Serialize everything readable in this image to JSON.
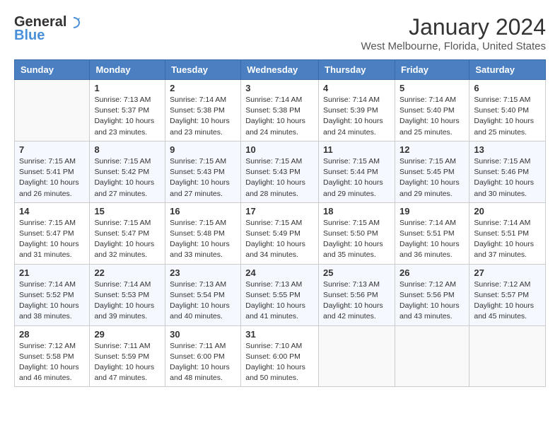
{
  "header": {
    "logo_general": "General",
    "logo_blue": "Blue",
    "title": "January 2024",
    "subtitle": "West Melbourne, Florida, United States"
  },
  "days_of_week": [
    "Sunday",
    "Monday",
    "Tuesday",
    "Wednesday",
    "Thursday",
    "Friday",
    "Saturday"
  ],
  "weeks": [
    [
      {
        "day": "",
        "info": ""
      },
      {
        "day": "1",
        "info": "Sunrise: 7:13 AM\nSunset: 5:37 PM\nDaylight: 10 hours\nand 23 minutes."
      },
      {
        "day": "2",
        "info": "Sunrise: 7:14 AM\nSunset: 5:38 PM\nDaylight: 10 hours\nand 23 minutes."
      },
      {
        "day": "3",
        "info": "Sunrise: 7:14 AM\nSunset: 5:38 PM\nDaylight: 10 hours\nand 24 minutes."
      },
      {
        "day": "4",
        "info": "Sunrise: 7:14 AM\nSunset: 5:39 PM\nDaylight: 10 hours\nand 24 minutes."
      },
      {
        "day": "5",
        "info": "Sunrise: 7:14 AM\nSunset: 5:40 PM\nDaylight: 10 hours\nand 25 minutes."
      },
      {
        "day": "6",
        "info": "Sunrise: 7:15 AM\nSunset: 5:40 PM\nDaylight: 10 hours\nand 25 minutes."
      }
    ],
    [
      {
        "day": "7",
        "info": "Sunrise: 7:15 AM\nSunset: 5:41 PM\nDaylight: 10 hours\nand 26 minutes."
      },
      {
        "day": "8",
        "info": "Sunrise: 7:15 AM\nSunset: 5:42 PM\nDaylight: 10 hours\nand 27 minutes."
      },
      {
        "day": "9",
        "info": "Sunrise: 7:15 AM\nSunset: 5:43 PM\nDaylight: 10 hours\nand 27 minutes."
      },
      {
        "day": "10",
        "info": "Sunrise: 7:15 AM\nSunset: 5:43 PM\nDaylight: 10 hours\nand 28 minutes."
      },
      {
        "day": "11",
        "info": "Sunrise: 7:15 AM\nSunset: 5:44 PM\nDaylight: 10 hours\nand 29 minutes."
      },
      {
        "day": "12",
        "info": "Sunrise: 7:15 AM\nSunset: 5:45 PM\nDaylight: 10 hours\nand 29 minutes."
      },
      {
        "day": "13",
        "info": "Sunrise: 7:15 AM\nSunset: 5:46 PM\nDaylight: 10 hours\nand 30 minutes."
      }
    ],
    [
      {
        "day": "14",
        "info": "Sunrise: 7:15 AM\nSunset: 5:47 PM\nDaylight: 10 hours\nand 31 minutes."
      },
      {
        "day": "15",
        "info": "Sunrise: 7:15 AM\nSunset: 5:47 PM\nDaylight: 10 hours\nand 32 minutes."
      },
      {
        "day": "16",
        "info": "Sunrise: 7:15 AM\nSunset: 5:48 PM\nDaylight: 10 hours\nand 33 minutes."
      },
      {
        "day": "17",
        "info": "Sunrise: 7:15 AM\nSunset: 5:49 PM\nDaylight: 10 hours\nand 34 minutes."
      },
      {
        "day": "18",
        "info": "Sunrise: 7:15 AM\nSunset: 5:50 PM\nDaylight: 10 hours\nand 35 minutes."
      },
      {
        "day": "19",
        "info": "Sunrise: 7:14 AM\nSunset: 5:51 PM\nDaylight: 10 hours\nand 36 minutes."
      },
      {
        "day": "20",
        "info": "Sunrise: 7:14 AM\nSunset: 5:51 PM\nDaylight: 10 hours\nand 37 minutes."
      }
    ],
    [
      {
        "day": "21",
        "info": "Sunrise: 7:14 AM\nSunset: 5:52 PM\nDaylight: 10 hours\nand 38 minutes."
      },
      {
        "day": "22",
        "info": "Sunrise: 7:14 AM\nSunset: 5:53 PM\nDaylight: 10 hours\nand 39 minutes."
      },
      {
        "day": "23",
        "info": "Sunrise: 7:13 AM\nSunset: 5:54 PM\nDaylight: 10 hours\nand 40 minutes."
      },
      {
        "day": "24",
        "info": "Sunrise: 7:13 AM\nSunset: 5:55 PM\nDaylight: 10 hours\nand 41 minutes."
      },
      {
        "day": "25",
        "info": "Sunrise: 7:13 AM\nSunset: 5:56 PM\nDaylight: 10 hours\nand 42 minutes."
      },
      {
        "day": "26",
        "info": "Sunrise: 7:12 AM\nSunset: 5:56 PM\nDaylight: 10 hours\nand 43 minutes."
      },
      {
        "day": "27",
        "info": "Sunrise: 7:12 AM\nSunset: 5:57 PM\nDaylight: 10 hours\nand 45 minutes."
      }
    ],
    [
      {
        "day": "28",
        "info": "Sunrise: 7:12 AM\nSunset: 5:58 PM\nDaylight: 10 hours\nand 46 minutes."
      },
      {
        "day": "29",
        "info": "Sunrise: 7:11 AM\nSunset: 5:59 PM\nDaylight: 10 hours\nand 47 minutes."
      },
      {
        "day": "30",
        "info": "Sunrise: 7:11 AM\nSunset: 6:00 PM\nDaylight: 10 hours\nand 48 minutes."
      },
      {
        "day": "31",
        "info": "Sunrise: 7:10 AM\nSunset: 6:00 PM\nDaylight: 10 hours\nand 50 minutes."
      },
      {
        "day": "",
        "info": ""
      },
      {
        "day": "",
        "info": ""
      },
      {
        "day": "",
        "info": ""
      }
    ]
  ]
}
